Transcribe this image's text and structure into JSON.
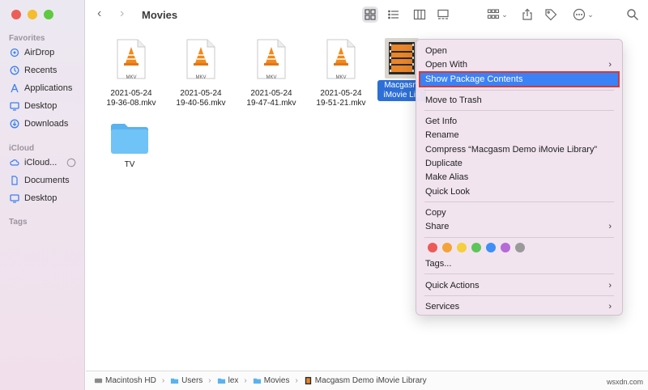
{
  "window": {
    "title": "Movies"
  },
  "sidebar": {
    "favorites_header": "Favorites",
    "favorites": [
      {
        "label": "AirDrop",
        "icon": "airdrop-icon"
      },
      {
        "label": "Recents",
        "icon": "clock-icon"
      },
      {
        "label": "Applications",
        "icon": "applications-icon"
      },
      {
        "label": "Desktop",
        "icon": "desktop-icon"
      },
      {
        "label": "Downloads",
        "icon": "downloads-icon"
      }
    ],
    "icloud_header": "iCloud",
    "icloud": [
      {
        "label": "iCloud...",
        "icon": "cloud-icon"
      },
      {
        "label": "Documents",
        "icon": "document-icon"
      },
      {
        "label": "Desktop",
        "icon": "desktop-icon"
      }
    ],
    "tags_header": "Tags"
  },
  "files": [
    {
      "line1": "2021-05-24",
      "line2": "19-36-08.mkv",
      "badge": "MKV"
    },
    {
      "line1": "2021-05-24",
      "line2": "19-40-56.mkv",
      "badge": "MKV"
    },
    {
      "line1": "2021-05-24",
      "line2": "19-47-41.mkv",
      "badge": "MKV"
    },
    {
      "line1": "2021-05-24",
      "line2": "19-51-21.mkv",
      "badge": "MKV"
    },
    {
      "line1": "Macgasm",
      "line2": "iMovie Lib"
    },
    {
      "line1": "TV",
      "line2": ""
    }
  ],
  "context_menu": {
    "items": [
      "Open",
      "Open With",
      "Show Package Contents",
      "Move to Trash",
      "Get Info",
      "Rename",
      "Compress “Macgasm Demo iMovie Library”",
      "Duplicate",
      "Make Alias",
      "Quick Look",
      "Copy",
      "Share",
      "Tags...",
      "Quick Actions",
      "Services"
    ],
    "tag_colors": [
      "#ec5b57",
      "#f4a338",
      "#f5cf3d",
      "#5ec55a",
      "#3f8ff7",
      "#b56ad8",
      "#9a9a9a"
    ]
  },
  "pathbar": [
    "Macintosh HD",
    "Users",
    "lex",
    "Movies",
    "Macgasm Demo iMovie Library"
  ],
  "watermark": "wsxdn.com"
}
